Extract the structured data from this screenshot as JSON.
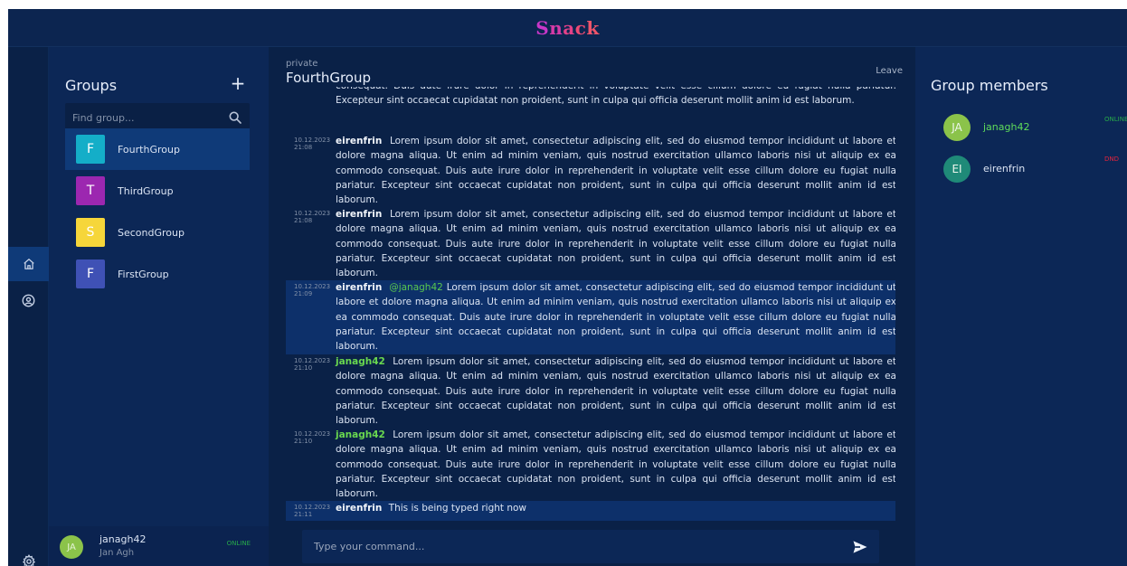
{
  "app": {
    "brand_letters": [
      "S",
      "n",
      "a",
      "c",
      "k"
    ],
    "brand_colors": [
      "#c837c9",
      "#d53aa6",
      "#e34188",
      "#ec4a73",
      "#f0546a"
    ]
  },
  "rail": {
    "icons": [
      "home-icon",
      "user-circle-icon",
      "gear-icon"
    ]
  },
  "groups": {
    "title": "Groups",
    "add_label": "+",
    "search_placeholder": "Find group...",
    "items": [
      {
        "initial": "F",
        "name": "FourthGroup",
        "color": "#14aec8",
        "active": true
      },
      {
        "initial": "T",
        "name": "ThirdGroup",
        "color": "#9c27b0",
        "active": false
      },
      {
        "initial": "S",
        "name": "SecondGroup",
        "color": "#f6d63a",
        "active": false
      },
      {
        "initial": "F",
        "name": "FirstGroup",
        "color": "#3f51b5",
        "active": false
      }
    ]
  },
  "current_user": {
    "initials": "JA",
    "username": "janagh42",
    "full_name": "Jan Agh",
    "status": "ONLINE"
  },
  "chat": {
    "visibility": "private",
    "title": "FourthGroup",
    "leave_label": "Leave",
    "composer_placeholder": "Type your command...",
    "messages": [
      {
        "date": "",
        "time": "",
        "author": "",
        "mention": "",
        "text": "consequat. Duis aute irure dolor in reprehenderit in voluptate velit esse cillum dolore eu fugiat nulla pariatur. Excepteur sint occaecat cupidatat non proident, sunt in culpa qui officia deserunt mollit anim id est laborum.",
        "self": false,
        "highlight": false
      },
      {
        "date": "10.12.2023",
        "time": "21:08",
        "author": "eirenfrin",
        "mention": "",
        "text": "Lorem ipsum dolor sit amet, consectetur adipiscing elit, sed do eiusmod tempor incididunt ut labore et dolore magna aliqua. Ut enim ad minim veniam, quis nostrud exercitation ullamco laboris nisi ut aliquip ex ea commodo consequat. Duis aute irure dolor in reprehenderit in voluptate velit esse cillum dolore eu fugiat nulla pariatur. Excepteur sint occaecat cupidatat non proident, sunt in culpa qui officia deserunt mollit anim id est laborum.",
        "self": false,
        "highlight": false
      },
      {
        "date": "10.12.2023",
        "time": "21:08",
        "author": "eirenfrin",
        "mention": "",
        "text": "Lorem ipsum dolor sit amet, consectetur adipiscing elit, sed do eiusmod tempor incididunt ut labore et dolore magna aliqua. Ut enim ad minim veniam, quis nostrud exercitation ullamco laboris nisi ut aliquip ex ea commodo consequat. Duis aute irure dolor in reprehenderit in voluptate velit esse cillum dolore eu fugiat nulla pariatur. Excepteur sint occaecat cupidatat non proident, sunt in culpa qui officia deserunt mollit anim id est laborum.",
        "self": false,
        "highlight": false
      },
      {
        "date": "10.12.2023",
        "time": "21:09",
        "author": "eirenfrin",
        "mention": "@janagh42",
        "text": "Lorem ipsum dolor sit amet, consectetur adipiscing elit, sed do eiusmod tempor incididunt ut labore et dolore magna aliqua. Ut enim ad minim veniam, quis nostrud exercitation ullamco laboris nisi ut aliquip ex ea commodo consequat. Duis aute irure dolor in reprehenderit in voluptate velit esse cillum dolore eu fugiat nulla pariatur. Excepteur sint occaecat cupidatat non proident, sunt in culpa qui officia deserunt mollit anim id est laborum.",
        "self": false,
        "highlight": true
      },
      {
        "date": "10.12.2023",
        "time": "21:10",
        "author": "janagh42",
        "mention": "",
        "text": "Lorem ipsum dolor sit amet, consectetur adipiscing elit, sed do eiusmod tempor incididunt ut labore et dolore magna aliqua. Ut enim ad minim veniam, quis nostrud exercitation ullamco laboris nisi ut aliquip ex ea commodo consequat. Duis aute irure dolor in reprehenderit in voluptate velit esse cillum dolore eu fugiat nulla pariatur. Excepteur sint occaecat cupidatat non proident, sunt in culpa qui officia deserunt mollit anim id est laborum.",
        "self": true,
        "highlight": false
      },
      {
        "date": "10.12.2023",
        "time": "21:10",
        "author": "janagh42",
        "mention": "",
        "text": "Lorem ipsum dolor sit amet, consectetur adipiscing elit, sed do eiusmod tempor incididunt ut labore et dolore magna aliqua. Ut enim ad minim veniam, quis nostrud exercitation ullamco laboris nisi ut aliquip ex ea commodo consequat. Duis aute irure dolor in reprehenderit in voluptate velit esse cillum dolore eu fugiat nulla pariatur. Excepteur sint occaecat cupidatat non proident, sunt in culpa qui officia deserunt mollit anim id est laborum.",
        "self": true,
        "highlight": false
      },
      {
        "date": "10.12.2023",
        "time": "21:11",
        "author": "eirenfrin",
        "mention": "",
        "text": "This is being typed right now",
        "self": false,
        "highlight": true
      }
    ]
  },
  "members": {
    "title": "Group members",
    "items": [
      {
        "initials": "JA",
        "name": "janagh42",
        "status": "ONLINE",
        "avatar_color": "#8bc34a",
        "name_color": "#5fdc5a",
        "status_color": "#27a84a"
      },
      {
        "initials": "EI",
        "name": "eirenfrin",
        "status": "DND",
        "avatar_color": "#1f8a78",
        "name_color": "#dbe4f3",
        "status_color": "#e3243c"
      }
    ]
  }
}
